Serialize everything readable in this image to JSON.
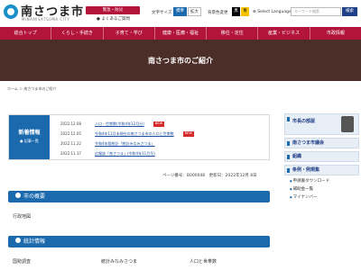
{
  "header": {
    "logo_text": "南さつま市",
    "logo_sub": "MINAMISATSUMA CITY",
    "disaster_button": "緊急・防災",
    "faq_link": "● よくあるご質問",
    "font_size_label": "文字サイズ",
    "font_size_options": [
      "標準",
      "拡大"
    ],
    "color_label": "背景色変更",
    "color_options": [
      "黒",
      "青"
    ],
    "language_label": "⊕ Select Language",
    "search_placeholder": "キーワード検索",
    "search_button": "検索"
  },
  "nav": [
    "総合トップ",
    "くらし・手続き",
    "子育て・学び",
    "健康・医療・福祉",
    "移住・定住",
    "産業・ビジネス",
    "市政情報"
  ],
  "hero": {
    "title": "南さつま市のご紹介"
  },
  "breadcrumb": "ホーム ＞ 南さつま市のご紹介",
  "news": {
    "title": "新着情報",
    "all_link": "● 記事一覧",
    "items": [
      {
        "date": "2022.12.08",
        "text": "人口・世帯数(令和4年12月分)",
        "tag": "NEW"
      },
      {
        "date": "2022.12.05",
        "text": "令和4年11月末現在の南さつま市の人口と世帯数",
        "tag": "NEW"
      },
      {
        "date": "2022.11.22",
        "text": "令和4年版統計「統計みなみさつま」",
        "tag": ""
      },
      {
        "date": "2022.11.17",
        "text": "広報誌「南さつま」(令和4年11月号)",
        "tag": ""
      }
    ]
  },
  "page_info": "ページ番号：B000048　更新日：2022年12月 8日",
  "sections": [
    {
      "title": "市の概要",
      "items": [
        "行政地図"
      ]
    },
    {
      "title": "統計情報",
      "items": [
        "国勢調査",
        "統計みなみさつま",
        "人口と世帯数"
      ]
    }
  ],
  "sidebar": {
    "boxes": [
      "市長の部屋",
      "南さつま市議会",
      "組織",
      "条例・例規集"
    ],
    "links": [
      "申請書ダウンロード",
      "補助金一覧",
      "マイナンバー"
    ]
  }
}
